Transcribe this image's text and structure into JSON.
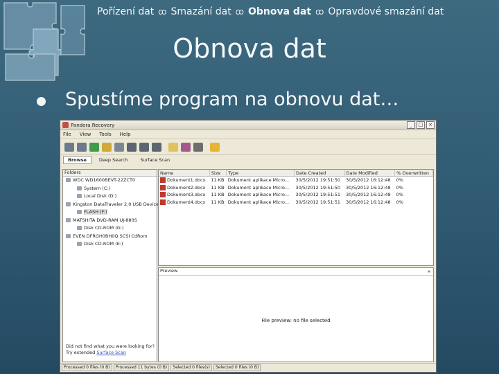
{
  "nav": {
    "items": [
      {
        "label": "Pořízení dat",
        "active": false
      },
      {
        "label": "Smazání dat",
        "active": false
      },
      {
        "label": "Obnova dat",
        "active": true
      },
      {
        "label": "Opravdové smazání dat",
        "active": false
      }
    ],
    "separator": "ꝏ"
  },
  "slide": {
    "title": "Obnova dat",
    "bullet": "Spustíme program na obnovu dat…"
  },
  "window": {
    "title": "Pandora Recovery",
    "controls": [
      "_",
      "□",
      "×"
    ],
    "menu": [
      "File",
      "View",
      "Tools",
      "Help"
    ],
    "tabs": [
      "Browse",
      "Deep Search",
      "Surface Scan"
    ],
    "tree_header": "Folders",
    "tree": [
      {
        "label": "WDC WD1600BEVT-22ZCT0",
        "indent": 0,
        "sel": false
      },
      {
        "label": "System (C:)",
        "indent": 1,
        "sel": false
      },
      {
        "label": "Local Disk (D:)",
        "indent": 1,
        "sel": false
      },
      {
        "label": "Kingston DataTraveler 2.0 USB Device",
        "indent": 0,
        "sel": false
      },
      {
        "label": "FLASH (F:)",
        "indent": 1,
        "sel": true
      },
      {
        "label": "MATSHITA DVD-RAM UJ-880S",
        "indent": 0,
        "sel": false
      },
      {
        "label": "Disk CD-ROM (G:)",
        "indent": 1,
        "sel": false
      },
      {
        "label": "EVEN DFRGH0BH0Q SCSI CdRom",
        "indent": 0,
        "sel": false
      },
      {
        "label": "Disk CD-ROM (E:)",
        "indent": 1,
        "sel": false
      }
    ],
    "left_footer": {
      "line1": "Did not find what you were looking for?",
      "line2": "Try extended",
      "link": "Surface Scan"
    },
    "columns": [
      "Name",
      "Size",
      "Type",
      "Date Created",
      "Date Modified",
      "% Overwritten"
    ],
    "rows": [
      [
        "Dokument1.docx",
        "11 KB",
        "Dokument aplikace Micro...",
        "30/5/2012 19:51:50",
        "30/5/2012 16:12:48",
        "0%"
      ],
      [
        "Dokument2.docx",
        "11 KB",
        "Dokument aplikace Micro...",
        "30/5/2012 19:51:50",
        "30/5/2012 16:12:48",
        "0%"
      ],
      [
        "Dokument3.docx",
        "11 KB",
        "Dokument aplikace Micro...",
        "30/5/2012 19:51:51",
        "30/5/2012 16:12:48",
        "0%"
      ],
      [
        "Dokument4.docx",
        "11 KB",
        "Dokument aplikace Micro...",
        "30/5/2012 19:51:51",
        "30/5/2012 16:12:48",
        "0%"
      ]
    ],
    "preview_label": "Preview",
    "preview_close": "×",
    "preview_message": "File preview: no file selected",
    "status": [
      "Processed 0 files (0 B)",
      "Processed 11 bytes (0 B)",
      "Selected 0 files(s)",
      "Selected 0 files (0 B)"
    ]
  },
  "colors": {
    "background": "#2f5a72",
    "window": "#ece9d8",
    "file_icon": "#c0392b"
  }
}
